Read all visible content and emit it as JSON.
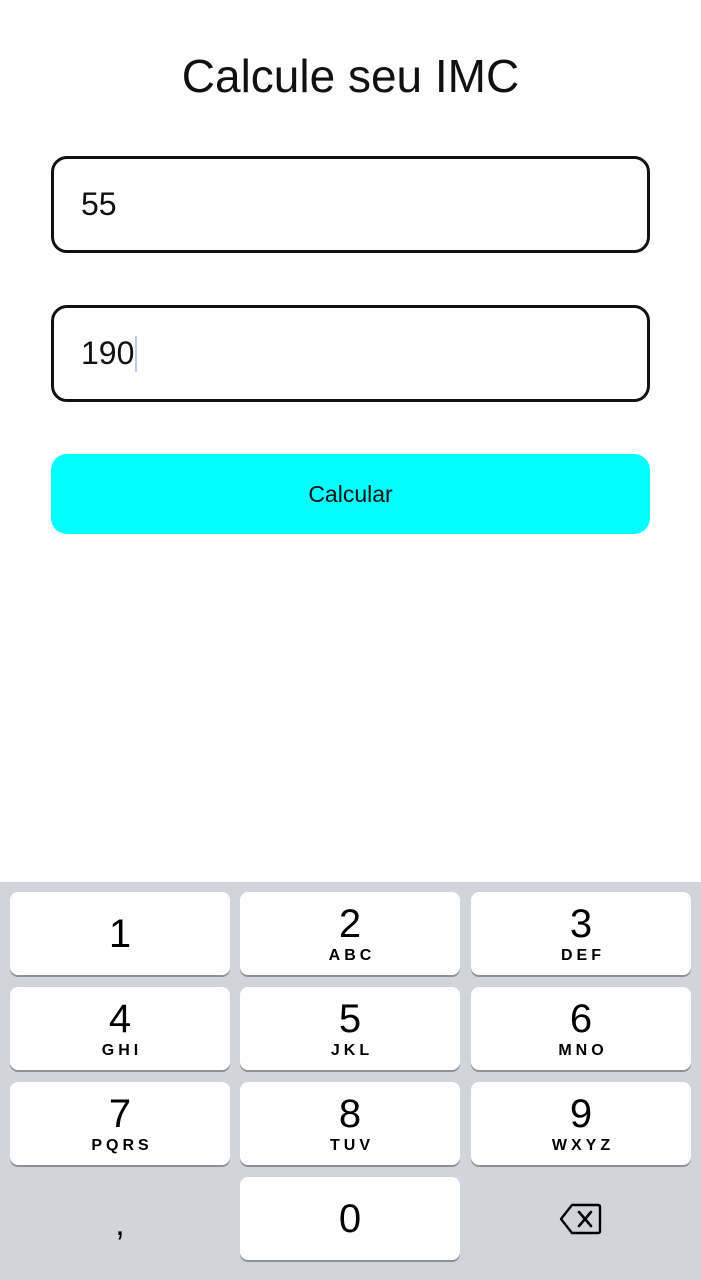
{
  "app": {
    "title": "Calcule seu IMC"
  },
  "form": {
    "weight_value": "55",
    "height_value": "190",
    "calculate_label": "Calcular"
  },
  "keyboard": {
    "keys": [
      {
        "digit": "1",
        "letters": ""
      },
      {
        "digit": "2",
        "letters": "ABC"
      },
      {
        "digit": "3",
        "letters": "DEF"
      },
      {
        "digit": "4",
        "letters": "GHI"
      },
      {
        "digit": "5",
        "letters": "JKL"
      },
      {
        "digit": "6",
        "letters": "MNO"
      },
      {
        "digit": "7",
        "letters": "PQRS"
      },
      {
        "digit": "8",
        "letters": "TUV"
      },
      {
        "digit": "9",
        "letters": "WXYZ"
      },
      {
        "digit": "0",
        "letters": ""
      }
    ],
    "comma_label": ",",
    "delete_icon": "backspace-icon"
  },
  "colors": {
    "accent": "#00ffff",
    "keyboard_bg": "#d1d4db",
    "key_bg": "#ffffff"
  }
}
